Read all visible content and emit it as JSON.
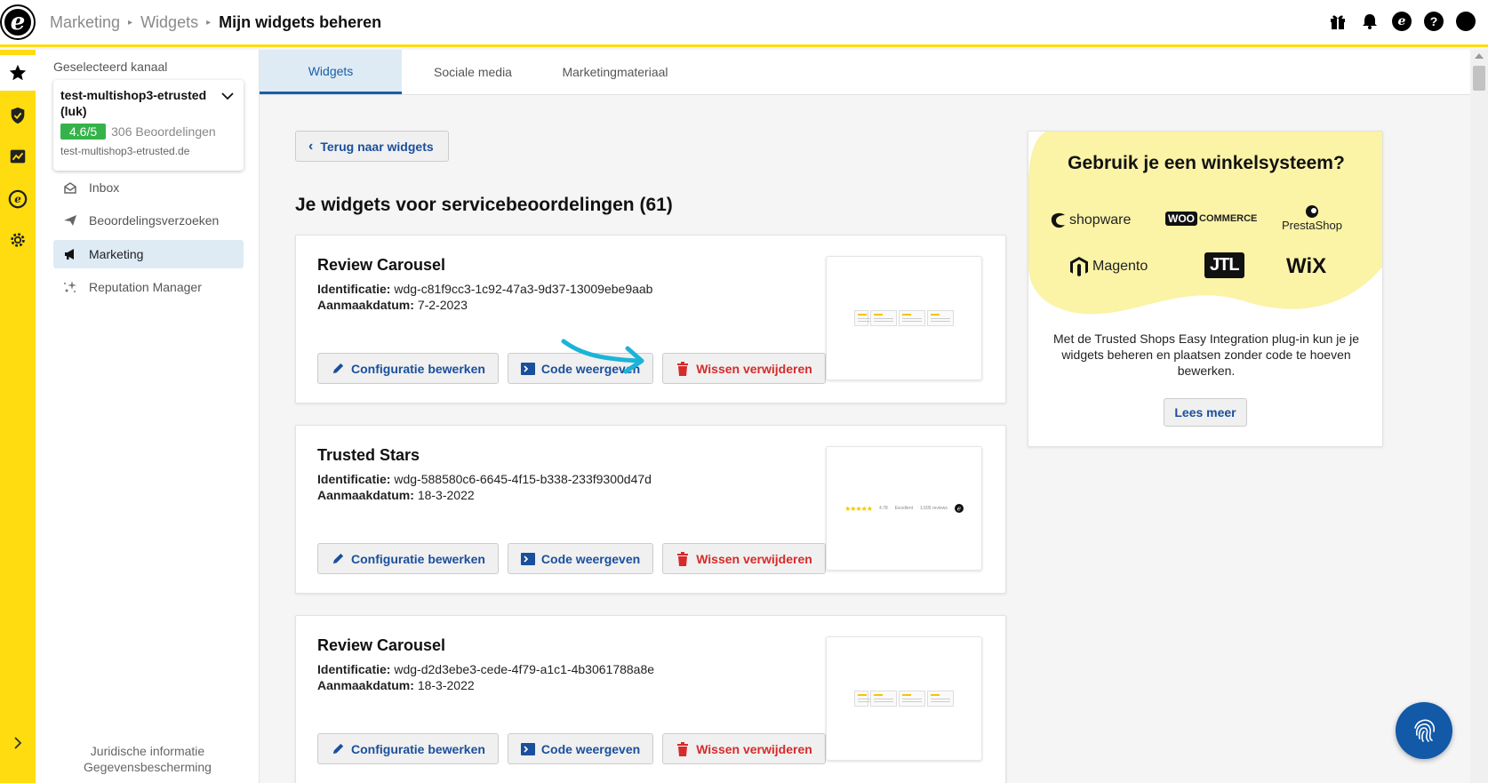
{
  "app": {
    "logo_letter": "e",
    "breadcrumb": [
      "Marketing",
      "Widgets"
    ],
    "breadcrumb_current": "Mijn widgets beheren",
    "top_icons": [
      "gift-icon",
      "bell-icon",
      "etrusted-icon",
      "help-icon",
      "profile-icon"
    ]
  },
  "rail": {
    "items": [
      "star-icon",
      "shield-check-icon",
      "chart-icon",
      "etrusted-icon",
      "gear-icon"
    ],
    "expand_icon": "chevron-right-icon"
  },
  "sidebar": {
    "channel_label": "Geselecteerd kanaal",
    "channel_name": "test-multishop3-etrusted (luk)",
    "rating": "4.6/5",
    "reviews": "306 Beoordelingen",
    "url": "test-multishop3-etrusted.de",
    "nav": [
      {
        "label": "Inbox",
        "icon": "inbox-icon"
      },
      {
        "label": "Beoordelingsverzoeken",
        "icon": "send-icon"
      },
      {
        "label": "Marketing",
        "icon": "megaphone-icon"
      },
      {
        "label": "Reputation Manager",
        "icon": "sparkle-icon"
      }
    ],
    "footer": [
      "Juridische informatie",
      "Gegevensbescherming"
    ]
  },
  "tabs": [
    "Widgets",
    "Sociale media",
    "Marketingmateriaal"
  ],
  "main": {
    "back_label": "Terug naar widgets",
    "section_title": "Je widgets voor servicebeoordelingen (61)",
    "id_label": "Identificatie:",
    "date_label": "Aanmaakdatum:",
    "btn_config": "Configuratie bewerken",
    "btn_code": "Code weergeven",
    "btn_delete": "Wissen verwijderen",
    "widgets": [
      {
        "name": "Review Carousel",
        "id": "wdg-c81f9cc3-1c92-47a3-9d37-13009ebe9aab",
        "date": "7-2-2023",
        "preview": "carousel"
      },
      {
        "name": "Trusted Stars",
        "id": "wdg-588580c6-6645-4f15-b338-233f9300d47d",
        "date": "18-3-2022",
        "preview": "stars"
      },
      {
        "name": "Review Carousel",
        "id": "wdg-d2d3ebe3-cede-4f79-a1c1-4b3061788a8e",
        "date": "18-3-2022",
        "preview": "carousel"
      }
    ],
    "stars_preview": {
      "score": "4.78",
      "grade": "Excellent",
      "count": "1,605 reviews"
    }
  },
  "promo": {
    "title": "Gebruik je een winkelsysteem?",
    "logos": [
      "shopware",
      "COMMERCE",
      "PrestaShop",
      "Magento",
      "JTL",
      "WiX"
    ],
    "woo": "WOO",
    "text": "Met de Trusted Shops Easy Integration plug-in kun je je widgets beheren en plaatsen zonder code te hoeven bewerken.",
    "button": "Lees meer"
  },
  "colors": {
    "brand_yellow": "#ffdc0f",
    "link_blue": "#1a4f9c",
    "danger_red": "#d62b2b",
    "rating_green": "#35b34a",
    "chat_blue": "#1259a7",
    "arrow_cyan": "#1cb3d8"
  }
}
